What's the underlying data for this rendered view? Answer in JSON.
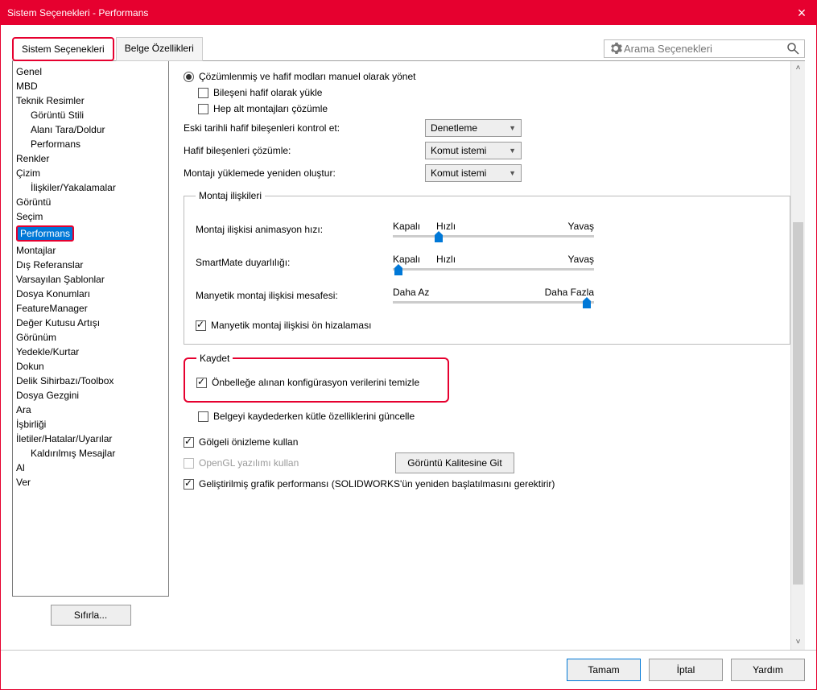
{
  "window": {
    "title": "Sistem Seçenekleri - Performans"
  },
  "tabs": {
    "system": "Sistem Seçenekleri",
    "document": "Belge Özellikleri"
  },
  "search": {
    "placeholder": "Arama Seçenekleri"
  },
  "tree": {
    "items": [
      "Genel",
      "MBD",
      "Teknik Resimler",
      "Görüntü Stili",
      "Alanı Tara/Doldur",
      "Performans",
      "Renkler",
      "Çizim",
      "İlişkiler/Yakalamalar",
      "Görüntü",
      "Seçim",
      "Performans",
      "Montajlar",
      "Dış Referanslar",
      "Varsayılan Şablonlar",
      "Dosya Konumları",
      "FeatureManager",
      "Değer Kutusu Artışı",
      "Görünüm",
      "Yedekle/Kurtar",
      "Dokun",
      "Delik Sihirbazı/Toolbox",
      "Dosya Gezgini",
      "Ara",
      "İşbirliği",
      "İletiler/Hatalar/Uyarılar",
      "Kaldırılmış Mesajlar",
      "Al",
      "Ver"
    ]
  },
  "reset": "Sıfırla...",
  "opts": {
    "radio1": "Çözümlenmiş ve hafif modları manuel olarak yönet",
    "cb_light": "Bileşeni hafif olarak yükle",
    "cb_sub": "Hep alt montajları çözümle",
    "row1": "Eski tarihli hafif bileşenleri kontrol et:",
    "sel1": "Denetleme",
    "row2": "Hafif bileşenleri çözümle:",
    "sel2": "Komut istemi",
    "row3": "Montajı yüklemede yeniden oluştur:",
    "sel3": "Komut istemi"
  },
  "assembly": {
    "legend": "Montaj ilişkileri",
    "s1": "Montaj ilişkisi animasyon hızı:",
    "s2": "SmartMate duyarlılığı:",
    "s3": "Manyetik montaj ilişkisi mesafesi:",
    "off": "Kapalı",
    "fast": "Hızlı",
    "slow": "Yavaş",
    "less": "Daha Az",
    "more": "Daha Fazla",
    "cb_mag": "Manyetik montaj ilişkisi ön hizalaması"
  },
  "save": {
    "legend": "Kaydet",
    "cb1": "Önbelleğe alınan konfigürasyon verilerini temizle",
    "cb2": "Belgeyi kaydederken kütle özelliklerini güncelle"
  },
  "bottom": {
    "cb_shaded": "Gölgeli önizleme kullan",
    "cb_opengl": "OpenGL yazılımı kullan",
    "btn_quality": "Görüntü Kalitesine Git",
    "cb_enhanced": "Geliştirilmiş grafik performansı (SOLIDWORKS'ün yeniden başlatılmasını gerektirir)"
  },
  "footer": {
    "ok": "Tamam",
    "cancel": "İptal",
    "help": "Yardım"
  }
}
